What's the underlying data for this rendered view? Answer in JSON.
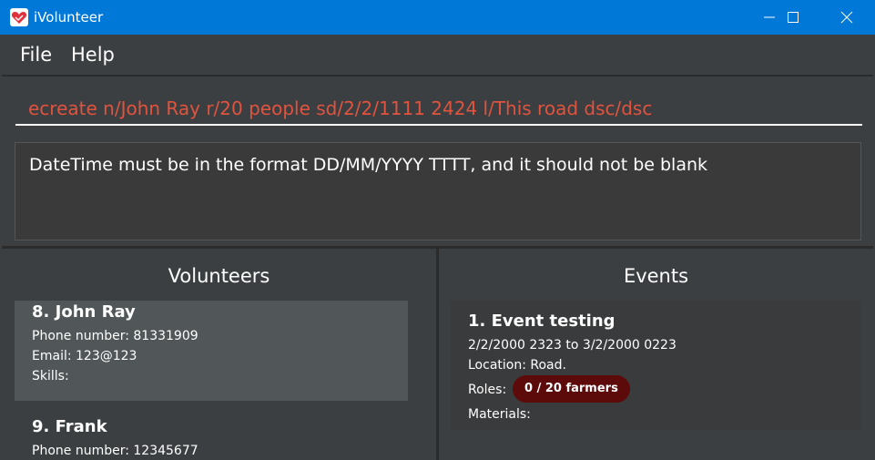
{
  "window": {
    "title": "iVolunteer"
  },
  "menu": {
    "file": "File",
    "help": "Help"
  },
  "command": {
    "value": "ecreate n/John Ray r/20 people sd/2/2/1111 2424 l/This road dsc/dsc"
  },
  "result": {
    "message": "DateTime must be in the format DD/MM/YYYY TTTT, and it should not be blank"
  },
  "volunteers": {
    "header": "Volunteers",
    "items": [
      {
        "name": "8.  John Ray",
        "phone": "Phone number: 81331909",
        "email": "Email: 123@123",
        "skills": "Skills:"
      },
      {
        "name": "9.  Frank",
        "phone": "Phone number: 12345677"
      }
    ]
  },
  "events": {
    "header": "Events",
    "items": [
      {
        "name": "1.  Event testing",
        "datetime": "2/2/2000 2323 to 3/2/2000 0223",
        "location": "Location: Road.",
        "roles_label": "Roles:",
        "role_badge": "0 / 20 farmers",
        "materials": "Materials:"
      }
    ]
  },
  "colors": {
    "titlebar": "#0078d7",
    "background": "#3c3f41",
    "command_text": "#e0533e",
    "selected_card": "#515658",
    "role_badge": "#5c0a0a"
  }
}
